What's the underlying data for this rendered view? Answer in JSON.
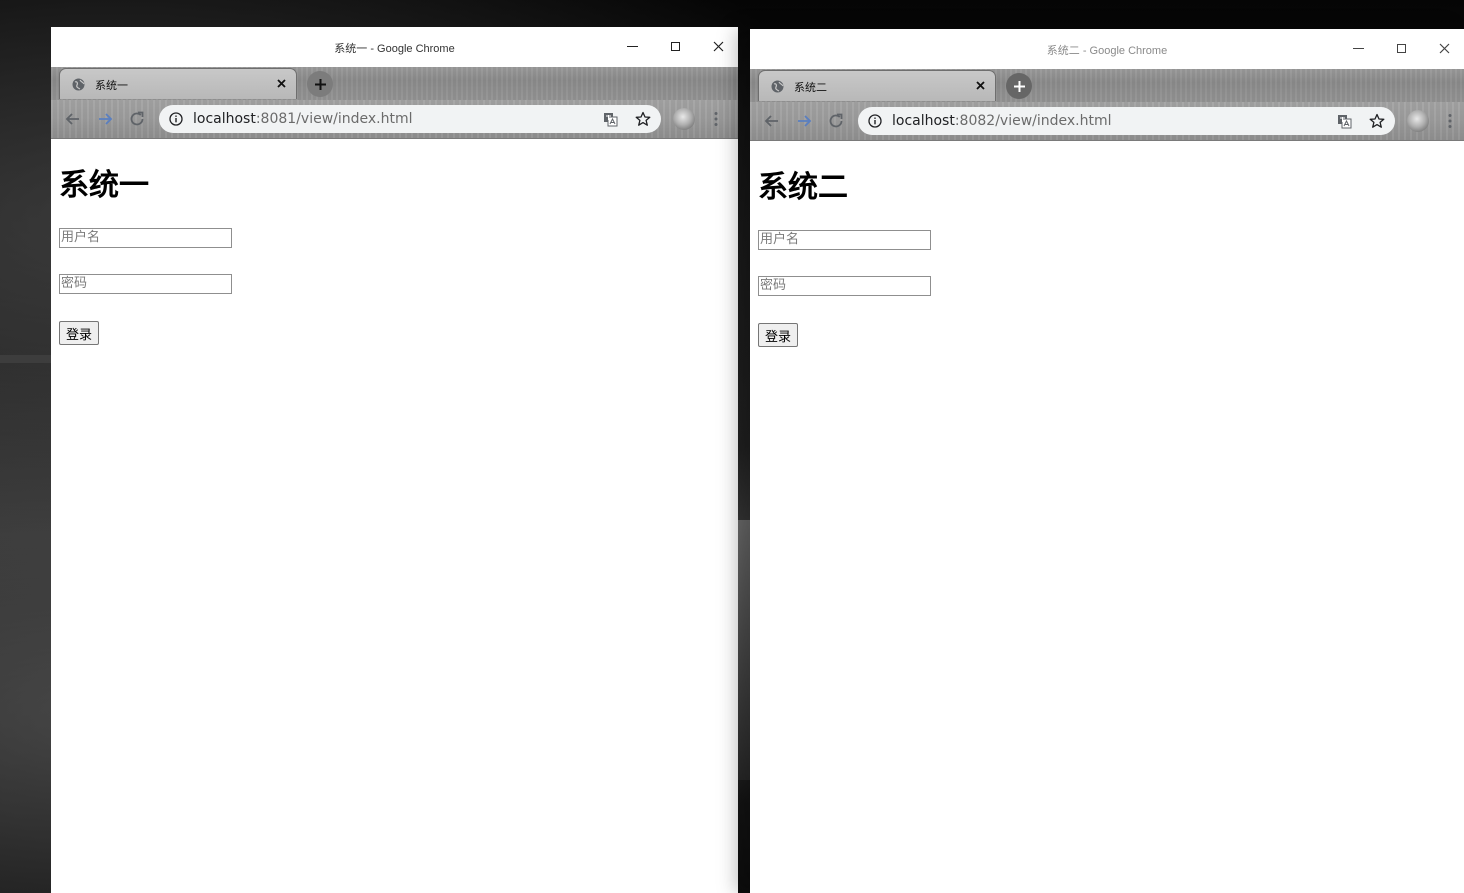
{
  "windows": [
    {
      "window_title": "系统一 - Google Chrome",
      "tab_title": "系统一",
      "url_host": "localhost",
      "url_rest": ":8081/view/index.html",
      "page": {
        "heading": "系统一",
        "username_placeholder": "用户名",
        "password_placeholder": "密码",
        "login_label": "登录"
      }
    },
    {
      "window_title": "系统二 - Google Chrome",
      "tab_title": "系统二",
      "url_host": "localhost",
      "url_rest": ":8082/view/index.html",
      "page": {
        "heading": "系统二",
        "username_placeholder": "用户名",
        "password_placeholder": "密码",
        "login_label": "登录"
      }
    }
  ],
  "icons": {
    "tab_favicon": "globe-icon",
    "tab_close": "close-icon",
    "new_tab": "plus-icon",
    "back": "arrow-left-icon",
    "forward": "arrow-right-icon",
    "reload": "reload-icon",
    "site_info": "info-icon",
    "translate": "translate-icon",
    "bookmark": "star-icon",
    "profile": "avatar",
    "menu": "kebab-menu-icon"
  },
  "colors": {
    "chrome_frame": "#9a9a9a",
    "omnibox": "#f1f3f4",
    "forward_arrow": "#5a7fc0"
  }
}
